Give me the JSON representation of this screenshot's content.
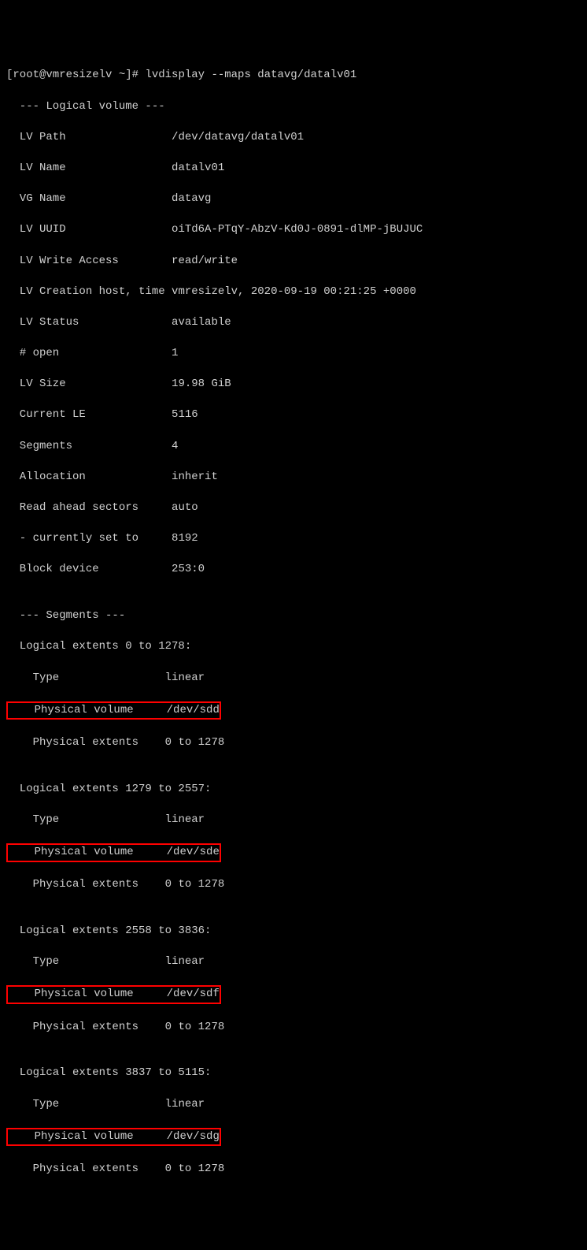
{
  "prompt": "[root@vmresizelv ~]# ",
  "command": "lvdisplay --maps datavg/datalv01",
  "lv_header": "  --- Logical volume ---",
  "lv_fields": [
    {
      "label": "  LV Path                ",
      "value": "/dev/datavg/datalv01"
    },
    {
      "label": "  LV Name                ",
      "value": "datalv01"
    },
    {
      "label": "  VG Name                ",
      "value": "datavg"
    },
    {
      "label": "  LV UUID                ",
      "value": "oiTd6A-PTqY-AbzV-Kd0J-0891-dlMP-jBUJUC"
    },
    {
      "label": "  LV Write Access        ",
      "value": "read/write"
    },
    {
      "label": "  LV Creation host, time ",
      "value": "vmresizelv, 2020-09-19 00:21:25 +0000"
    },
    {
      "label": "  LV Status              ",
      "value": "available"
    },
    {
      "label": "  # open                 ",
      "value": "1"
    },
    {
      "label": "  LV Size                ",
      "value": "19.98 GiB"
    },
    {
      "label": "  Current LE             ",
      "value": "5116"
    },
    {
      "label": "  Segments               ",
      "value": "4"
    },
    {
      "label": "  Allocation             ",
      "value": "inherit"
    },
    {
      "label": "  Read ahead sectors     ",
      "value": "auto"
    },
    {
      "label": "  - currently set to     ",
      "value": "8192"
    },
    {
      "label": "  Block device           ",
      "value": "253:0"
    }
  ],
  "seg_header": "  --- Segments ---",
  "segments": [
    {
      "extents": "  Logical extents 0 to 1278:",
      "type_label": "    Type                ",
      "type_value": "linear",
      "pv_label": "    Physical volume     ",
      "pv_value": "/dev/sdd",
      "pe_label": "    Physical extents    ",
      "pe_value": "0 to 1278"
    },
    {
      "extents": "  Logical extents 1279 to 2557:",
      "type_label": "    Type                ",
      "type_value": "linear",
      "pv_label": "    Physical volume     ",
      "pv_value": "/dev/sde",
      "pe_label": "    Physical extents    ",
      "pe_value": "0 to 1278"
    },
    {
      "extents": "  Logical extents 2558 to 3836:",
      "type_label": "    Type                ",
      "type_value": "linear",
      "pv_label": "    Physical volume     ",
      "pv_value": "/dev/sdf",
      "pe_label": "    Physical extents    ",
      "pe_value": "0 to 1278"
    },
    {
      "extents": "  Logical extents 3837 to 5115:",
      "type_label": "    Type                ",
      "type_value": "linear",
      "pv_label": "    Physical volume     ",
      "pv_value": "/dev/sdg",
      "pe_label": "    Physical extents    ",
      "pe_value": "0 to 1278"
    }
  ]
}
